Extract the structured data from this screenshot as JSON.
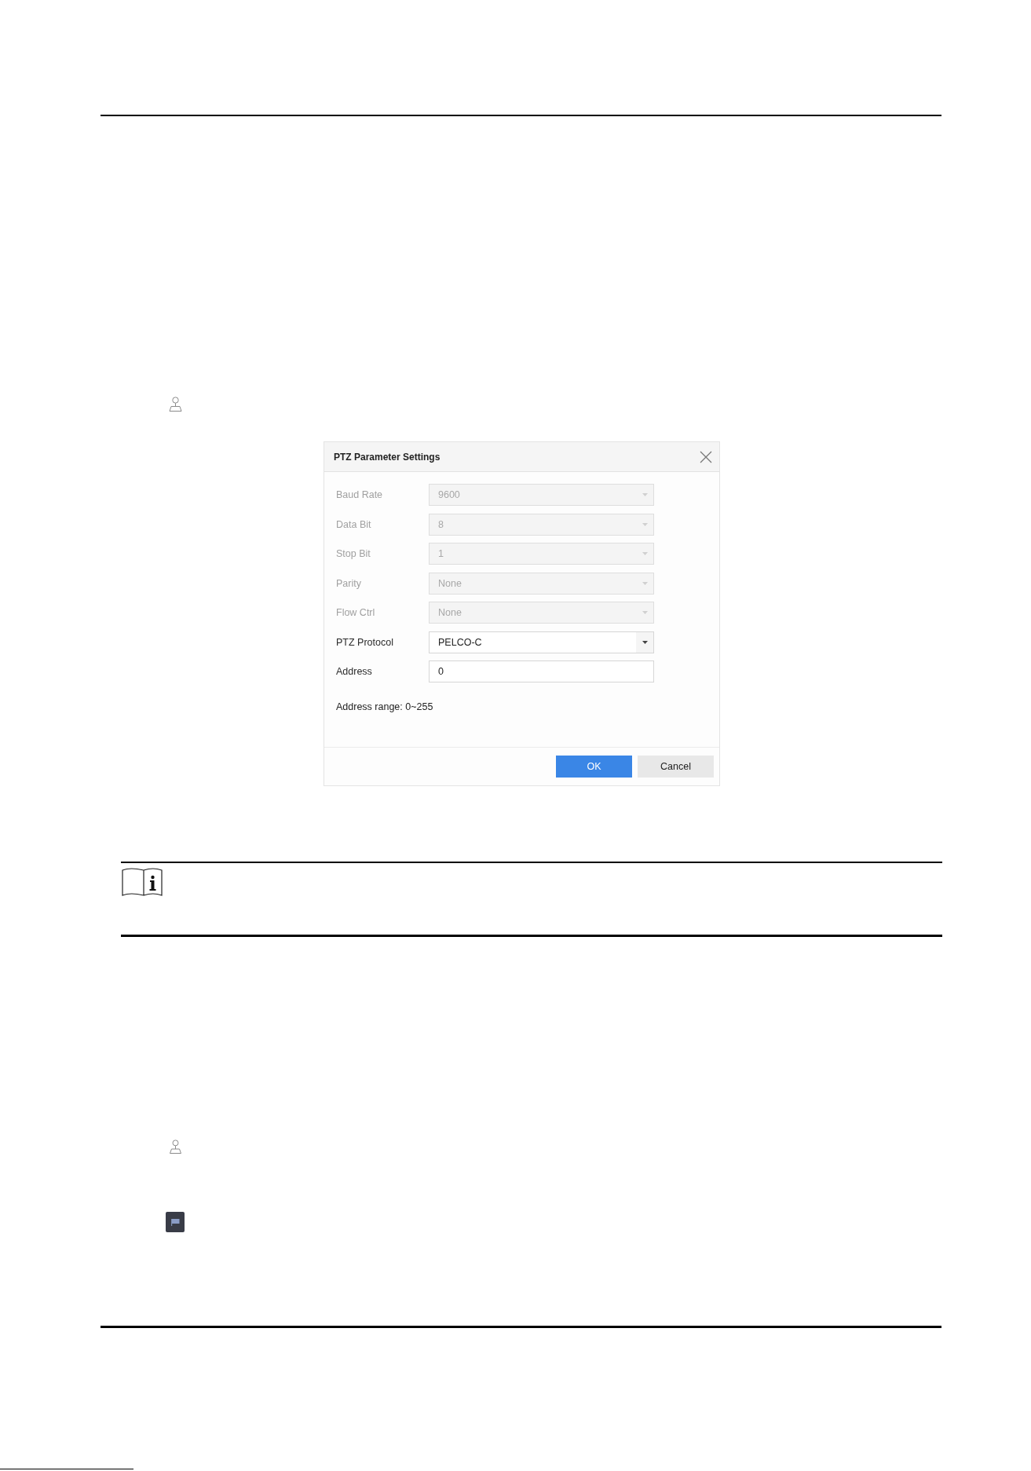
{
  "dialog": {
    "title": "PTZ Parameter Settings",
    "fields": [
      {
        "label": "Baud Rate",
        "value": "9600",
        "kind": "select",
        "disabled": true
      },
      {
        "label": "Data Bit",
        "value": "8",
        "kind": "select",
        "disabled": true
      },
      {
        "label": "Stop Bit",
        "value": "1",
        "kind": "select",
        "disabled": true
      },
      {
        "label": "Parity",
        "value": "None",
        "kind": "select",
        "disabled": true
      },
      {
        "label": "Flow Ctrl",
        "value": "None",
        "kind": "select",
        "disabled": true
      },
      {
        "label": "PTZ Protocol",
        "value": "PELCO-C",
        "kind": "select",
        "disabled": false
      },
      {
        "label": "Address",
        "value": "0",
        "kind": "input",
        "disabled": false
      }
    ],
    "hint": "Address range: 0~255",
    "buttons": [
      {
        "label": "OK",
        "kind": "primary"
      },
      {
        "label": "Cancel",
        "kind": "secondary"
      }
    ]
  }
}
